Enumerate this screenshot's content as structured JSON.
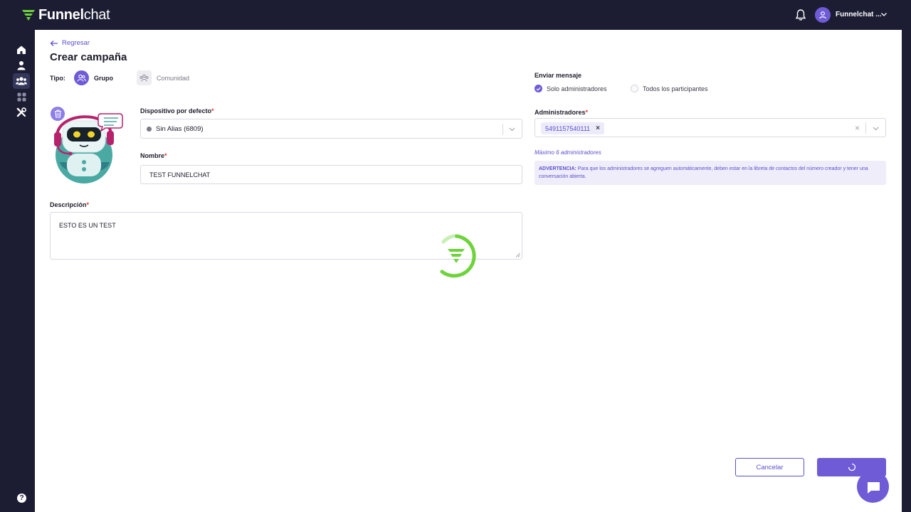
{
  "app": {
    "logo_light": "Funnel",
    "logo_bold": "chat"
  },
  "header": {
    "user_name": "Funnelchat ..."
  },
  "page": {
    "back_label": "Regresar",
    "title": "Crear campaña"
  },
  "tipo": {
    "label": "Tipo:",
    "options": [
      {
        "label": "Grupo",
        "selected": true
      },
      {
        "label": "Comunidad",
        "selected": false
      }
    ]
  },
  "form": {
    "device_label": "Dispositivo por defecto",
    "device_value": "Sin Alias (6809)",
    "name_label": "Nombre",
    "name_value": "TEST FUNNELCHAT",
    "description_label": "Descripción",
    "description_value": "ESTO ES UN TEST",
    "required_mark": "*"
  },
  "send": {
    "label": "Enviar mensaje",
    "options": [
      {
        "label": "Solo administradores",
        "selected": true
      },
      {
        "label": "Todos los participantes",
        "selected": false
      }
    ]
  },
  "admins": {
    "label": "Administradores",
    "chips": [
      "5491157540111"
    ],
    "max_note": "Máximo 6 administradores",
    "warning_title": "ADVERTENCIA:",
    "warning_text": " Para que los administradores se agreguen automáticamente, deben estar en la libreta de contactos del número creador y tener una conversación abierta."
  },
  "actions": {
    "cancel_label": "Cancelar"
  },
  "colors": {
    "accent": "#6f5bd6",
    "brand_green": "#6fd33c",
    "nav_bg": "#1c1d33"
  }
}
